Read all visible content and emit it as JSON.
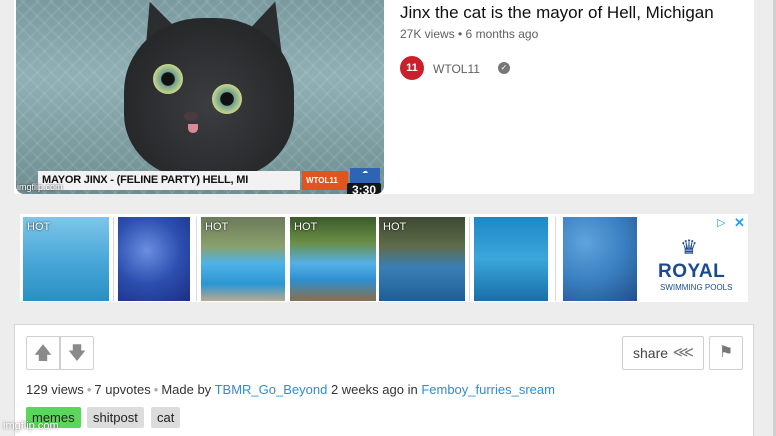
{
  "meme": {
    "video_title": "Jinx the cat is the mayor of Hell, Michigan",
    "video_meta": "27K views • 6 months ago",
    "channel_logo": "11",
    "channel_name": "WTOL11",
    "lower_third": "MAYOR JINX - (FELINE PARTY) HELL, MI",
    "lower_logo": "WTOL11",
    "duration": "3:30",
    "watermark": "imgflip.com"
  },
  "ad": {
    "tiles": [
      {
        "badge": "HOT"
      },
      {
        "badge": ""
      },
      {
        "badge": "HOT"
      },
      {
        "badge": "HOT"
      },
      {
        "badge": "HOT"
      },
      {
        "badge": ""
      },
      {
        "badge": ""
      }
    ],
    "brand_name": "ROYAL",
    "brand_sub": "SWIMMING POOLS",
    "choices_icon": "adchoices-icon",
    "close_glyph": "✕"
  },
  "post": {
    "views": "129 views",
    "upvotes": "7 upvotes",
    "made_by_prefix": "Made by",
    "author": "TBMR_Go_Beyond",
    "time": "2 weeks ago",
    "in_label": "in",
    "stream": "Femboy_furries_sream",
    "share_label": "share",
    "tags": [
      "memes",
      "shitpost",
      "cat"
    ],
    "watermark": "imgflip.com"
  },
  "colors": {
    "link": "#2d8ed0",
    "tag_green": "#5ad65a",
    "royal_blue": "#1b4a93",
    "youtube_red": "#cc1f2c"
  }
}
